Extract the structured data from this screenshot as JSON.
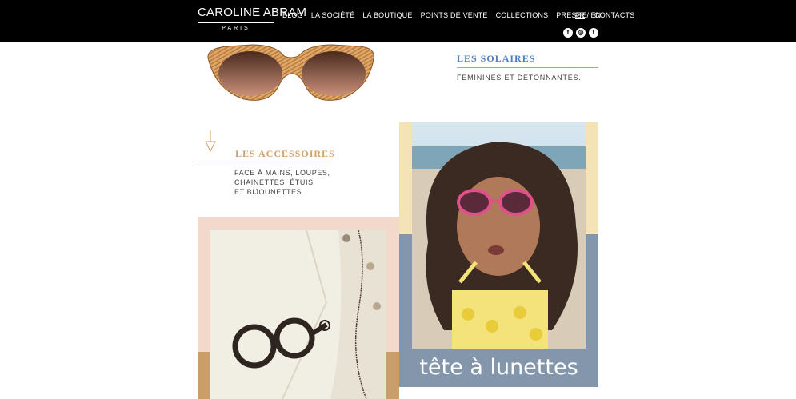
{
  "header": {
    "logo_main": "CAROLINE ABRAM",
    "logo_sub": "PARIS",
    "nav": [
      "BLOG",
      "LA SOCIÉTÉ",
      "LA BOUTIQUE",
      "POINTS DE VENTE",
      "COLLECTIONS",
      "PRESSE",
      "CONTACTS"
    ],
    "lang_fr": "FR",
    "lang_sep": "/",
    "lang_en": "EN",
    "socials": [
      {
        "icon": "facebook-icon",
        "glyph": "f"
      },
      {
        "icon": "instagram-icon",
        "glyph": "◎"
      },
      {
        "icon": "twitter-icon",
        "glyph": "t"
      }
    ]
  },
  "solaires": {
    "title": "LES SOLAIRES",
    "subtitle": "FÉMININES ET DÉTONNANTES."
  },
  "accessoires": {
    "title": "LES ACCESSOIRES",
    "lines": [
      "FACE À MAINS, LOUPES,",
      "CHAINETTES, ÉTUIS",
      "ET BIJOUNETTES"
    ]
  },
  "kids": {
    "label": "tête à lunettes"
  },
  "colors": {
    "topbar": "#000000",
    "blue_accent": "#4a7fbf",
    "gold_accent": "#d2a06a",
    "pink_panel": "#f2d9cb",
    "yellow_panel": "#f5e3b8",
    "slate_panel": "#8496ac"
  }
}
